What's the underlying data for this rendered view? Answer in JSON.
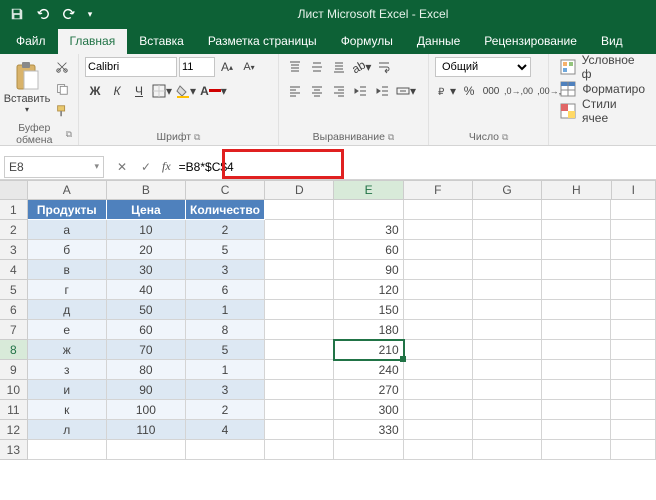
{
  "title": "Лист Microsoft Excel - Excel",
  "tabs": {
    "file": "Файл",
    "home": "Главная",
    "insert": "Вставка",
    "layout": "Разметка страницы",
    "formulas": "Формулы",
    "data": "Данные",
    "review": "Рецензирование",
    "view": "Вид"
  },
  "ribbon": {
    "paste": "Вставить",
    "clipboard_group": "Буфер обмена",
    "font_group": "Шрифт",
    "align_group": "Выравнивание",
    "number_group": "Число",
    "font_name": "Calibri",
    "font_size": "11",
    "bold": "Ж",
    "italic": "К",
    "underline": "Ч",
    "number_format": "Общий",
    "cond_fmt": "Условное ф",
    "fmt_table": "Форматиро",
    "cell_styles": "Стили ячее"
  },
  "namebox": "E8",
  "formula": "=B8*$C$4",
  "columns": [
    "A",
    "B",
    "C",
    "D",
    "E",
    "F",
    "G",
    "H",
    "I"
  ],
  "headers": {
    "A": "Продукты",
    "B": "Цена",
    "C": "Количество"
  },
  "rows": [
    {
      "n": 1,
      "A": "",
      "B": "",
      "C": "",
      "E": ""
    },
    {
      "n": 2,
      "A": "а",
      "B": "10",
      "C": "2",
      "E": "30"
    },
    {
      "n": 3,
      "A": "б",
      "B": "20",
      "C": "5",
      "E": "60"
    },
    {
      "n": 4,
      "A": "в",
      "B": "30",
      "C": "3",
      "E": "90"
    },
    {
      "n": 5,
      "A": "г",
      "B": "40",
      "C": "6",
      "E": "120"
    },
    {
      "n": 6,
      "A": "д",
      "B": "50",
      "C": "1",
      "E": "150"
    },
    {
      "n": 7,
      "A": "е",
      "B": "60",
      "C": "8",
      "E": "180"
    },
    {
      "n": 8,
      "A": "ж",
      "B": "70",
      "C": "5",
      "E": "210"
    },
    {
      "n": 9,
      "A": "з",
      "B": "80",
      "C": "1",
      "E": "240"
    },
    {
      "n": 10,
      "A": "и",
      "B": "90",
      "C": "3",
      "E": "270"
    },
    {
      "n": 11,
      "A": "к",
      "B": "100",
      "C": "2",
      "E": "300"
    },
    {
      "n": 12,
      "A": "л",
      "B": "110",
      "C": "4",
      "E": "330"
    },
    {
      "n": 13,
      "A": "",
      "B": "",
      "C": "",
      "E": ""
    }
  ],
  "selected": {
    "row": 8,
    "col": "E"
  }
}
